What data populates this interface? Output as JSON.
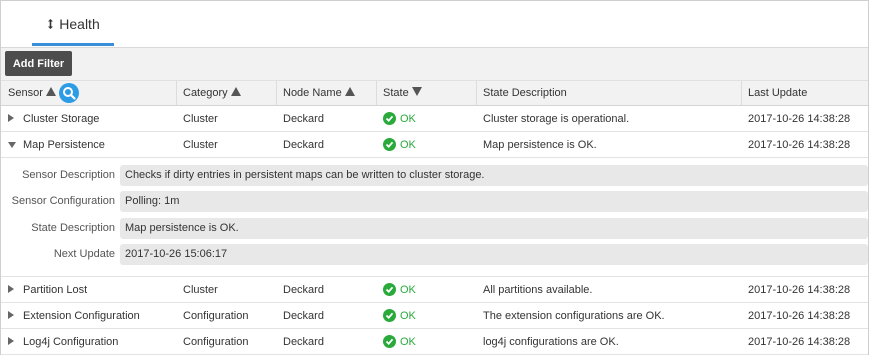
{
  "tab": {
    "label": "Health",
    "icon": "refresh-icon"
  },
  "toolbar": {
    "add_filter_label": "Add Filter"
  },
  "columns": {
    "sensor": "Sensor",
    "category": "Category",
    "node": "Node Name",
    "state": "State",
    "description": "State Description",
    "update": "Last Update"
  },
  "colors": {
    "accent": "#3b8fd9",
    "ok": "#2aaa3b",
    "search": "#2d9be6",
    "button": "#4d4d4d"
  },
  "rows": [
    {
      "sensor": "Cluster Storage",
      "category": "Cluster",
      "node": "Deckard",
      "state": "OK",
      "description": "Cluster storage is operational.",
      "update": "2017-10-26 14:38:28",
      "expanded": false
    },
    {
      "sensor": "Map Persistence",
      "category": "Cluster",
      "node": "Deckard",
      "state": "OK",
      "description": "Map persistence is OK.",
      "update": "2017-10-26 14:38:28",
      "expanded": true
    },
    {
      "sensor": "Partition Lost",
      "category": "Cluster",
      "node": "Deckard",
      "state": "OK",
      "description": "All partitions available.",
      "update": "2017-10-26 14:38:28",
      "expanded": false
    },
    {
      "sensor": "Extension Configuration",
      "category": "Configuration",
      "node": "Deckard",
      "state": "OK",
      "description": "The extension configurations are OK.",
      "update": "2017-10-26 14:38:28",
      "expanded": false
    },
    {
      "sensor": "Log4j Configuration",
      "category": "Configuration",
      "node": "Deckard",
      "state": "OK",
      "description": "log4j configurations are OK.",
      "update": "2017-10-26 14:38:28",
      "expanded": false
    }
  ],
  "detail": {
    "sensor_description_label": "Sensor Description",
    "sensor_description": "Checks if dirty entries in persistent maps can be written to cluster storage.",
    "sensor_configuration_label": "Sensor Configuration",
    "sensor_configuration": "Polling: 1m",
    "state_description_label": "State Description",
    "state_description": "Map persistence is OK.",
    "next_update_label": "Next Update",
    "next_update": "2017-10-26 15:06:17"
  }
}
